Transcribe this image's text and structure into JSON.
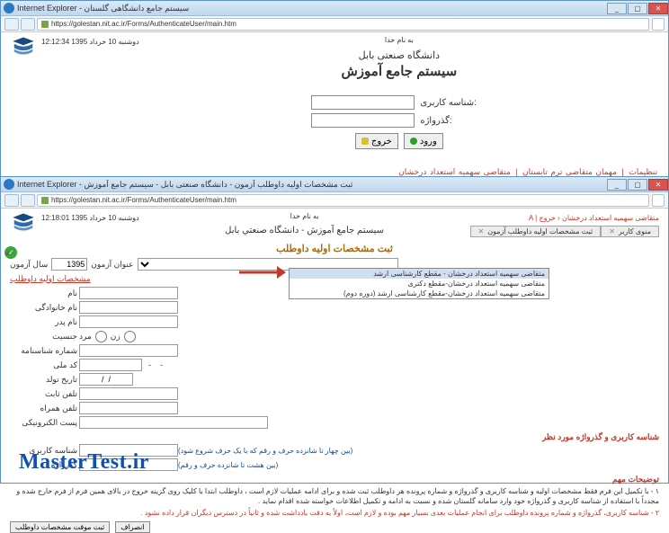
{
  "win1": {
    "title": "Internet Explorer - سیستم جامع دانشگاهی گلستان",
    "url": "https://golestan.nit.ac.ir/Forms/AuthenticateUser/main.htm",
    "datetime": "12:12:34  دوشنبه 10 خرداد 1395",
    "top_caption": "به نام خدا",
    "uni": "دانشگاه صنعتی بابل",
    "sys": "سيستم جامع آموزش",
    "user_label": "شناسه کاربری:",
    "pass_label": "گذرواژه:",
    "btn_enter": "ورود",
    "btn_exit": "خروج",
    "links": {
      "l1": "تنظیمات",
      "l2": "مهمان متقاضی ترم تابستان",
      "l3": "متقاضی سهمیه استعداد درخشان"
    }
  },
  "win2": {
    "title": "Internet Explorer - ثبت مشخصات اوليه داوطلب آزمون - دانشگاه صنعتی بابل - سيستم جامع آموزش",
    "url": "https://golestan.nit.ac.ir/Forms/AuthenticateUser/main.htm",
    "datetime": "12:18:01  دوشنبه 10 خرداد 1395",
    "top_caption": "به نام خدا",
    "breadcrumb": "A  |  متقاضی سهمیه استعداد درخشان  ‹ خروج",
    "tab1": "منوی کاربر",
    "tab2": "ثبت مشخصات اولیه داوطلب آزمون",
    "sys_line": "سيستم جامع آموزش  -  دانشگاه صنعتي بابل",
    "section": "ثبت مشخصات اولیه داوطلب",
    "year_label": "سال آزمون",
    "year_value": "1395",
    "exam_title_label": "عنوان آزمون",
    "dd_selected": "متقاضی سهمیه استعداد درخشان - مقطع کارشناسی ارشد",
    "dd_options": [
      "متقاضی سهمیه استعداد درخشان - مقطع کارشناسی ارشد",
      "متقاضی سهمیه استعداد درخشان-مقطع دکتری",
      "متقاضی سهمیه استعداد درخشان-مقطع کارشناسی ارشد (دوره دوم)"
    ],
    "link_initial": "مشخصات اولیه داوطلب",
    "lbl_name": "نام",
    "lbl_family": "نام خانوادگی",
    "lbl_father": "نام پدر",
    "lbl_gender": "جنسیت",
    "gender_f": "زن",
    "gender_m": "مرد",
    "lbl_idnum": "شماره شناسنامه",
    "lbl_natid": "کد ملی",
    "lbl_birth": "تاریخ تولد",
    "lbl_tel": "تلفن ثابت",
    "lbl_mobile": "تلفن همراه",
    "lbl_email": "پست الکترونیکی",
    "credentials_title": "شناسه کاربری و گذرواژه مورد نظر",
    "lbl_user": "شناسه کاربری",
    "user_hint": "(بین چهار تا شانزده حرف و رقم که با یک حرف شروع شود)",
    "lbl_pass": "گذرواژه",
    "pass_hint": "(بین هشت تا شانزده حرف و رقم)",
    "notes_title": "توضیحات مهم",
    "note1": "۱ - با تکمیل این فرم فقط مشخصات اولیه و شناسه کاربری و گذرواژه و شماره پرونده هر داوطلب ثبت شده و برای ادامه عملیات لازم است ، داوطلب ابتدا با کلیک روی گزینه خروج در بالای همین فرم از فرم خارج شده و مجدداً با استفاده از شناسه کاربری و گذرواژه خود وارد سامانه گلستان شده و نسبت به ادامه و تکمیل اطلاعات خواسته شده اقدام نماید .",
    "note2": "۲ - شناسه کاربری، گذرواژه و شماره پرونده داوطلب برای انجام عملیات بعدی بسیار مهم بوده و لازم است، اولاً به دقت یادداشت شده و ثانیاً در دسترس دیگران قرار داده نشود .",
    "btn_temp_save": "ثبت موقت مشخصات داوطلب",
    "btn_cancel": "انصراف"
  },
  "watermark": "MasterTest.ir"
}
